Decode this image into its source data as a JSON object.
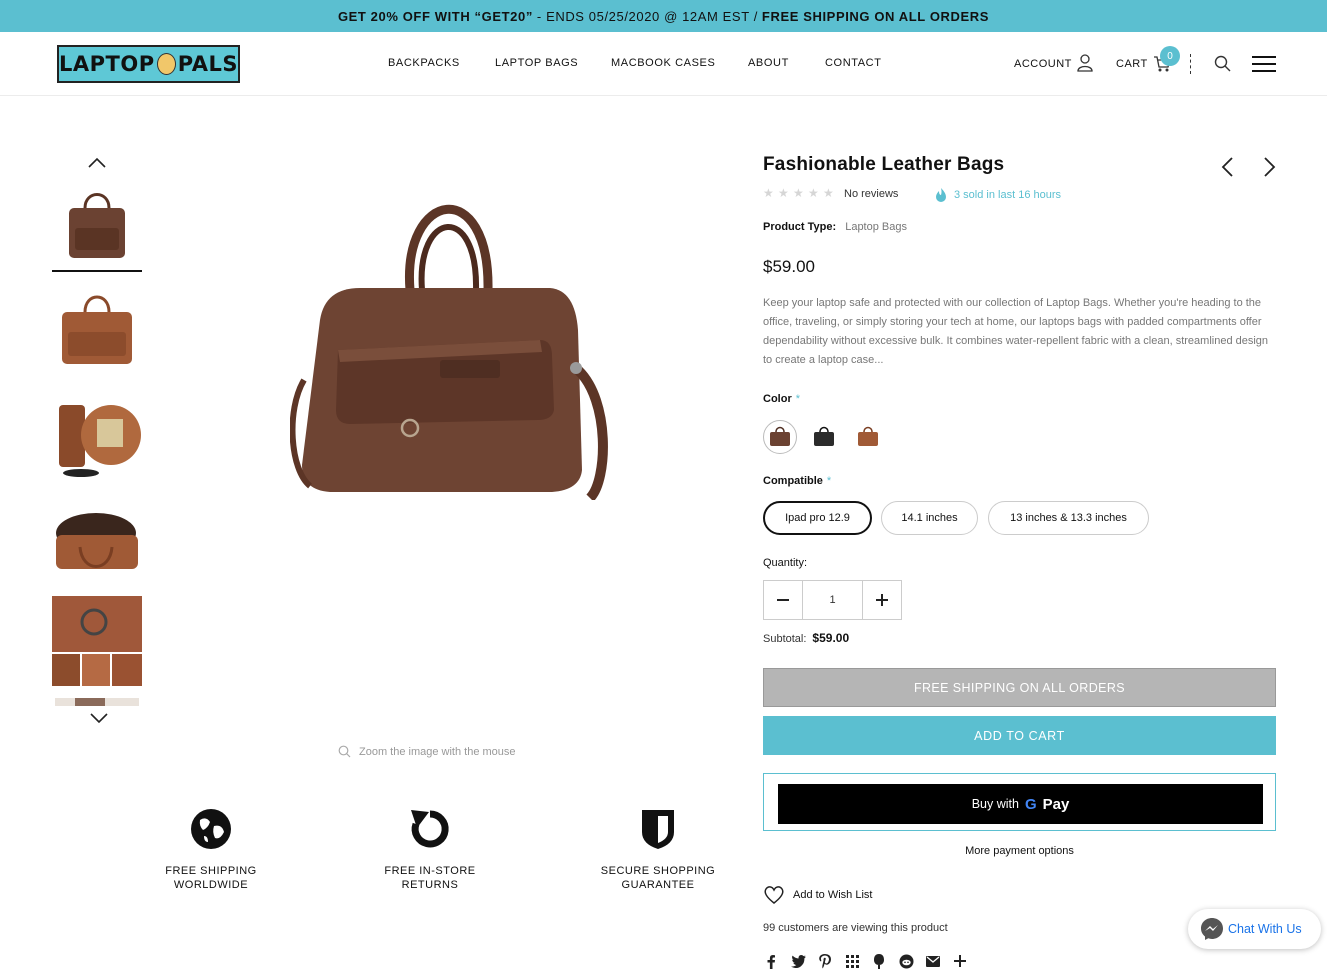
{
  "announcement": {
    "part1": "GET 20% OFF WITH “GET20”",
    "part2": "- ENDS 05/25/2020 @ 12AM EST /",
    "part3": "FREE SHIPPING ON ALL ORDERS"
  },
  "logo": {
    "left": "LAPTOP",
    "right": "PALS"
  },
  "nav": [
    {
      "label": "BACKPACKS"
    },
    {
      "label": "LAPTOP BAGS"
    },
    {
      "label": "MACBOOK CASES"
    },
    {
      "label": "ABOUT"
    },
    {
      "label": "CONTACT"
    }
  ],
  "header": {
    "account": "ACCOUNT",
    "cart": "CART",
    "cart_count": "0"
  },
  "gallery": {
    "zoom_hint": "Zoom the image with the mouse"
  },
  "features": [
    {
      "line1": "FREE SHIPPING",
      "line2": "WORLDWIDE",
      "icon": "globe-icon"
    },
    {
      "line1": "FREE IN-STORE",
      "line2": "RETURNS",
      "icon": "return-arrow-icon"
    },
    {
      "line1": "SECURE SHOPPING",
      "line2": "GUARANTEE",
      "icon": "shield-icon"
    }
  ],
  "product": {
    "title": "Fashionable Leather Bags",
    "reviews": "No reviews",
    "rating_stars": 0,
    "sold": "3 sold in last 16 hours",
    "type_label": "Product Type:",
    "type_value": "Laptop Bags",
    "price": "$59.00",
    "description": "Keep your laptop safe and protected with our collection of Laptop Bags. Whether you're heading to the office, traveling, or simply storing your tech at home, our laptops bags with padded compartments offer dependability without excessive bulk. It combines water-repellent fabric with a clean, streamlined design to create a laptop case...",
    "color_label": "Color",
    "required_mark": "*",
    "compatible_label": "Compatible",
    "compatible_options": [
      "Ipad pro 12.9",
      "14.1 inches",
      "13 inches & 13.3 inches"
    ],
    "quantity_label": "Quantity:",
    "quantity": "1",
    "subtotal_label": "Subtotal:",
    "subtotal": "$59.00",
    "ship_button": "FREE SHIPPING ON ALL ORDERS",
    "add_button": "ADD TO CART",
    "gpay_text": "Buy with",
    "gpay_brand": "Pay",
    "more_payment": "More payment options",
    "wishlist": "Add to Wish List",
    "viewers": "99 customers are viewing this product"
  },
  "chat": {
    "label": "Chat With Us"
  },
  "colors": {
    "accent": "#5bbfd0",
    "bag_dark_brown": "#6b4232",
    "bag_black": "#2b2b2b",
    "bag_tan": "#a05a36"
  }
}
